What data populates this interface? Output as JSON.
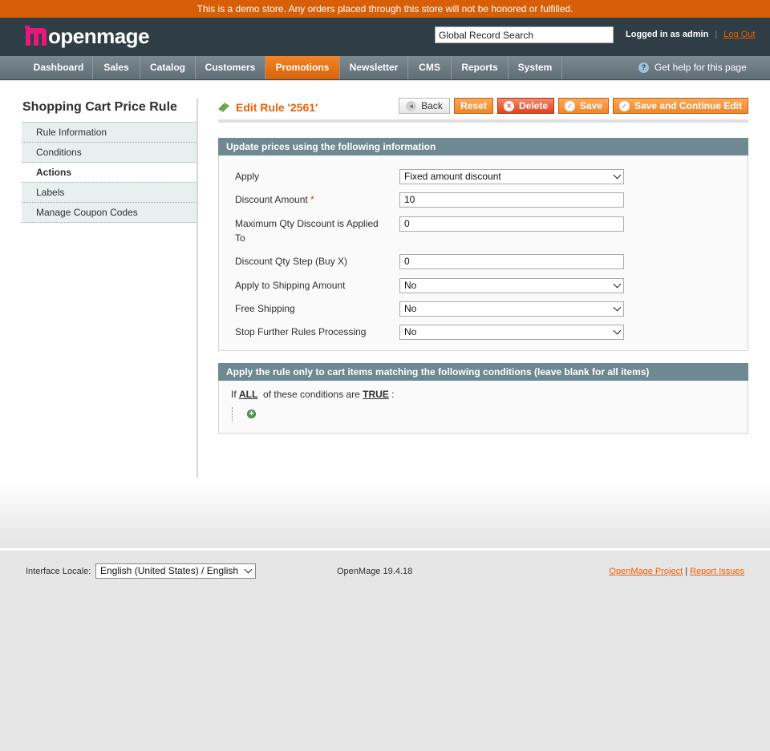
{
  "demo_notice": "This is a demo store. Any orders placed through this store will not be honored or fulfilled.",
  "brand": {
    "logo_text": "openmage",
    "accent": "#eb5e00",
    "logo_mark_color": "#e8177d"
  },
  "header": {
    "search_value": "Global Record Search",
    "logged_in_label": "Logged in as admin",
    "separator": "|",
    "logout_label": "Log Out"
  },
  "nav": {
    "items": [
      "Dashboard",
      "Sales",
      "Catalog",
      "Customers",
      "Promotions",
      "Newsletter",
      "CMS",
      "Reports",
      "System"
    ],
    "active": "Promotions",
    "help_label": "Get help for this page",
    "help_icon": "help-icon"
  },
  "sidebar": {
    "title": "Shopping Cart Price Rule",
    "tabs": [
      "Rule Information",
      "Conditions",
      "Actions",
      "Labels",
      "Manage Coupon Codes"
    ],
    "active_tab": "Actions"
  },
  "page": {
    "title": "Edit Rule '2561'",
    "buttons": {
      "back": "Back",
      "reset": "Reset",
      "delete": "Delete",
      "save": "Save",
      "save_continue": "Save and Continue Edit"
    }
  },
  "actions_section": {
    "heading": "Update prices using the following information",
    "fields": {
      "apply_label": "Apply",
      "apply_value": "Fixed amount discount",
      "discount_amount_label": "Discount Amount",
      "discount_amount_required": "*",
      "discount_amount_value": "10",
      "max_qty_label": "Maximum Qty Discount is Applied To",
      "max_qty_value": "0",
      "qty_step_label": "Discount Qty Step (Buy X)",
      "qty_step_value": "0",
      "apply_shipping_label": "Apply to Shipping Amount",
      "apply_shipping_value": "No",
      "free_shipping_label": "Free Shipping",
      "free_shipping_value": "No",
      "stop_rules_label": "Stop Further Rules Processing",
      "stop_rules_value": "No"
    }
  },
  "conditions_section": {
    "heading": "Apply the rule only to cart items matching the following conditions (leave blank for all items)",
    "if_text": "If",
    "aggregator": "ALL",
    "middle_text": "of these conditions are",
    "value": "TRUE",
    "colon": ":"
  },
  "footer": {
    "locale_label": "Interface Locale:",
    "locale_value": "English (United States) / English",
    "version": "OpenMage 19.4.18",
    "project_link": "OpenMage Project",
    "link_separator": "|",
    "report_link": "Report Issues"
  }
}
